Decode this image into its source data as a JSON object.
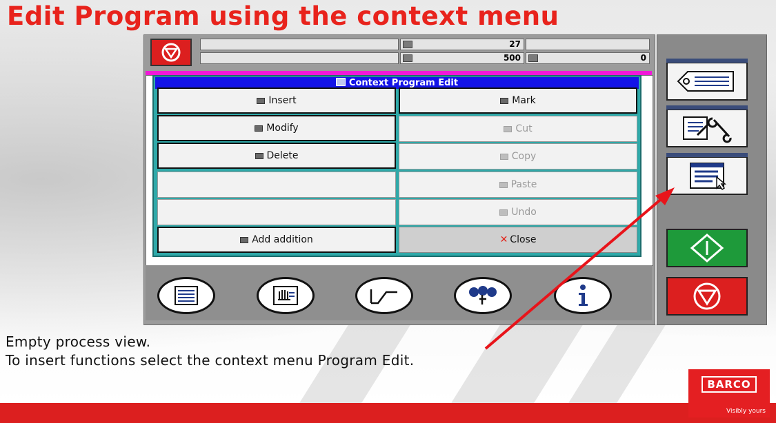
{
  "slide": {
    "title": "Edit Program using the context menu",
    "caption_line1": "Empty process view.",
    "caption_line2": "To insert functions select the context menu Program Edit."
  },
  "status_bar": {
    "value_top": "27",
    "value_bottom_left": "500",
    "value_bottom_right": "0"
  },
  "context_menu": {
    "title": "Context Program Edit",
    "left_items": [
      {
        "label": "Insert",
        "state": "active",
        "icon": "insert-icon"
      },
      {
        "label": "Modify",
        "state": "active",
        "icon": "modify-icon"
      },
      {
        "label": "Delete",
        "state": "active",
        "icon": "delete-icon"
      },
      {
        "label": "",
        "state": "empty"
      },
      {
        "label": "",
        "state": "empty"
      },
      {
        "label": "Add addition",
        "state": "active",
        "icon": "add-addition-icon"
      }
    ],
    "right_items": [
      {
        "label": "Mark",
        "state": "active",
        "icon": "mark-icon"
      },
      {
        "label": "Cut",
        "state": "disabled",
        "icon": "cut-icon"
      },
      {
        "label": "Copy",
        "state": "disabled",
        "icon": "copy-icon"
      },
      {
        "label": "Paste",
        "state": "disabled",
        "icon": "paste-icon"
      },
      {
        "label": "Undo",
        "state": "disabled",
        "icon": "undo-icon"
      },
      {
        "label": "Close",
        "state": "close",
        "icon": "close-x-icon"
      }
    ]
  },
  "logo": {
    "brand": "BARCO",
    "tagline": "Visibly yours"
  },
  "colors": {
    "title_red": "#e8231c",
    "menu_title_blue": "#1414e8",
    "menu_frame_teal": "#2fa9a9",
    "start_green": "#1e9a3a",
    "stop_red": "#dc1f1f"
  }
}
